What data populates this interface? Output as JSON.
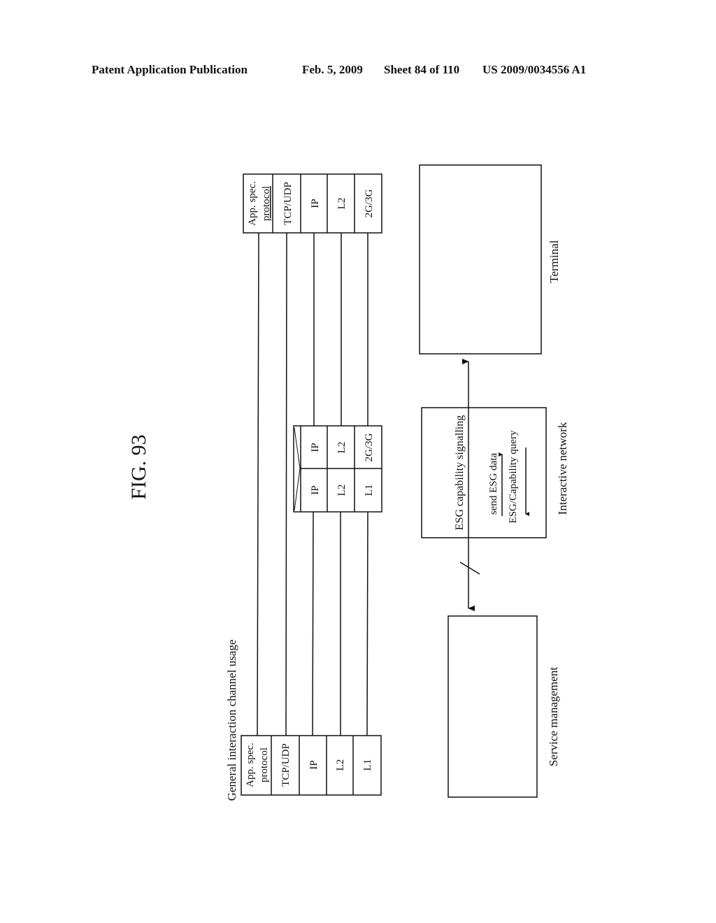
{
  "header": {
    "publication": "Patent Application Publication",
    "date": "Feb. 5, 2009",
    "sheet": "Sheet 84 of 110",
    "number": "US 2009/0034556 A1"
  },
  "figure": {
    "label": "FIG. 93",
    "caption": "General interaction channel usage",
    "terminal_stack": [
      "App. spec. protocol",
      "TCP/UDP",
      "IP",
      "L2",
      "2G/3G"
    ],
    "terminal_stack_app_lines": [
      "App. spec.",
      "protocol"
    ],
    "network_stack": {
      "left": [
        "IP",
        "L2",
        "L1"
      ],
      "right": [
        "IP",
        "L2",
        "2G/3G"
      ]
    },
    "service_stack": [
      "App. spec. protocol",
      "TCP/UDP",
      "IP",
      "L2",
      "L1"
    ],
    "service_stack_app_lines": [
      "App. spec.",
      "protocol"
    ],
    "terminal_label": "Terminal",
    "network_box_title": "ESG capability signalling",
    "send_label": "send ESG data",
    "query_label": "ESG/Capability query",
    "network_label": "Interactive network",
    "service_label": "Service management"
  }
}
